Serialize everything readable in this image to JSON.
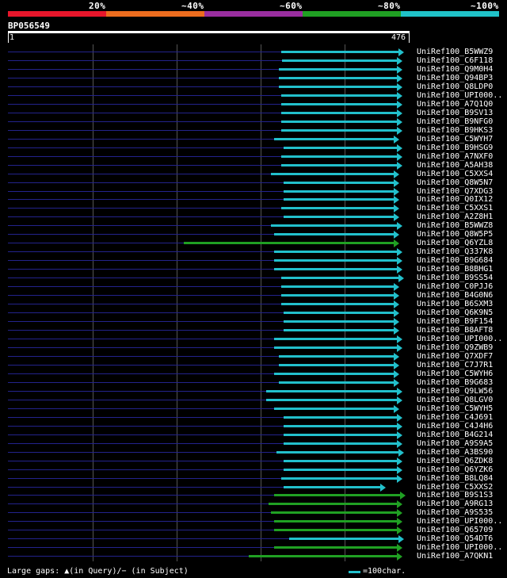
{
  "identity_legend": {
    "labels": [
      "20%",
      "~40%",
      "~60%",
      "~80%",
      "~100%"
    ],
    "colors": [
      "#e8162b",
      "#ec6c1e",
      "#9a2ea0",
      "#20a023",
      "#20c2c8"
    ]
  },
  "query": {
    "id": "BP056549",
    "start": "1",
    "end": "476"
  },
  "hits": [
    {
      "name": "UniRef100_B5WWZ9",
      "start": 355,
      "end": 503,
      "color": "#22c0cc",
      "arrow": true
    },
    {
      "name": "UniRef100_C6F118",
      "start": 356,
      "end": 501,
      "color": "#22c0cc",
      "arrow": true
    },
    {
      "name": "UniRef100_Q9M0H4",
      "start": 352,
      "end": 501,
      "color": "#22c0cc",
      "arrow": true
    },
    {
      "name": "UniRef100_Q94BP3",
      "start": 352,
      "end": 501,
      "color": "#22c0cc",
      "arrow": true
    },
    {
      "name": "UniRef100_Q8LDP0",
      "start": 352,
      "end": 501,
      "color": "#22c0cc",
      "arrow": true
    },
    {
      "name": "UniRef100_UPI000..",
      "start": 355,
      "end": 501,
      "color": "#22c0cc",
      "arrow": true
    },
    {
      "name": "UniRef100_A7Q1Q0",
      "start": 355,
      "end": 501,
      "color": "#22c0cc",
      "arrow": true
    },
    {
      "name": "UniRef100_B9SV13",
      "start": 355,
      "end": 501,
      "color": "#22c0cc",
      "arrow": true
    },
    {
      "name": "UniRef100_B9NFG0",
      "start": 355,
      "end": 501,
      "color": "#22c0cc",
      "arrow": true
    },
    {
      "name": "UniRef100_B9HKS3",
      "start": 355,
      "end": 501,
      "color": "#22c0cc",
      "arrow": true
    },
    {
      "name": "UniRef100_C5WYH7",
      "start": 346,
      "end": 497,
      "color": "#22c0cc",
      "arrow": true
    },
    {
      "name": "UniRef100_B9HSG9",
      "start": 358,
      "end": 501,
      "color": "#22c0cc",
      "arrow": true
    },
    {
      "name": "UniRef100_A7NXF0",
      "start": 355,
      "end": 501,
      "color": "#22c0cc",
      "arrow": true
    },
    {
      "name": "UniRef100_A5AH38",
      "start": 355,
      "end": 501,
      "color": "#22c0cc",
      "arrow": true
    },
    {
      "name": "UniRef100_C5XXS4",
      "start": 342,
      "end": 497,
      "color": "#22c0cc",
      "arrow": true
    },
    {
      "name": "UniRef100_Q8W5N7",
      "start": 358,
      "end": 497,
      "color": "#22c0cc",
      "arrow": true
    },
    {
      "name": "UniRef100_Q7XDG3",
      "start": 358,
      "end": 497,
      "color": "#22c0cc",
      "arrow": true
    },
    {
      "name": "UniRef100_Q0IX12",
      "start": 358,
      "end": 497,
      "color": "#22c0cc",
      "arrow": true
    },
    {
      "name": "UniRef100_C5XXS1",
      "start": 355,
      "end": 497,
      "color": "#22c0cc",
      "arrow": true
    },
    {
      "name": "UniRef100_A2Z8H1",
      "start": 358,
      "end": 497,
      "color": "#22c0cc",
      "arrow": true
    },
    {
      "name": "UniRef100_B5WWZ8",
      "start": 342,
      "end": 501,
      "color": "#22c0cc",
      "arrow": true
    },
    {
      "name": "UniRef100_Q8W5P5",
      "start": 346,
      "end": 497,
      "color": "#22c0cc",
      "arrow": true
    },
    {
      "name": "UniRef100_Q6YZL8",
      "start": 232,
      "end": 497,
      "color": "#20a023",
      "arrow": true
    },
    {
      "name": "UniRef100_Q337K8",
      "start": 346,
      "end": 501,
      "color": "#22c0cc",
      "arrow": true
    },
    {
      "name": "UniRef100_B9G684",
      "start": 346,
      "end": 501,
      "color": "#22c0cc",
      "arrow": true
    },
    {
      "name": "UniRef100_B8BHG1",
      "start": 346,
      "end": 501,
      "color": "#22c0cc",
      "arrow": true
    },
    {
      "name": "UniRef100_B9SS54",
      "start": 355,
      "end": 503,
      "color": "#22c0cc",
      "arrow": true
    },
    {
      "name": "UniRef100_C0PJJ6",
      "start": 355,
      "end": 497,
      "color": "#22c0cc",
      "arrow": true
    },
    {
      "name": "UniRef100_B4G0N6",
      "start": 355,
      "end": 497,
      "color": "#22c0cc",
      "arrow": true
    },
    {
      "name": "UniRef100_B6SXM3",
      "start": 355,
      "end": 497,
      "color": "#22c0cc",
      "arrow": true
    },
    {
      "name": "UniRef100_Q6K9N5",
      "start": 358,
      "end": 497,
      "color": "#22c0cc",
      "arrow": true
    },
    {
      "name": "UniRef100_B9F154",
      "start": 358,
      "end": 497,
      "color": "#22c0cc",
      "arrow": true
    },
    {
      "name": "UniRef100_B8AFT8",
      "start": 358,
      "end": 497,
      "color": "#22c0cc",
      "arrow": true
    },
    {
      "name": "UniRef100_UPI000..",
      "start": 346,
      "end": 501,
      "color": "#22c0cc",
      "arrow": true
    },
    {
      "name": "UniRef100_Q9ZWB9",
      "start": 346,
      "end": 501,
      "color": "#22c0cc",
      "arrow": true
    },
    {
      "name": "UniRef100_Q7XDF7",
      "start": 352,
      "end": 497,
      "color": "#22c0cc",
      "arrow": true
    },
    {
      "name": "UniRef100_C7J7R1",
      "start": 352,
      "end": 497,
      "color": "#22c0cc",
      "arrow": true
    },
    {
      "name": "UniRef100_C5WYH6",
      "start": 346,
      "end": 497,
      "color": "#22c0cc",
      "arrow": true
    },
    {
      "name": "UniRef100_B9G683",
      "start": 352,
      "end": 497,
      "color": "#22c0cc",
      "arrow": true
    },
    {
      "name": "UniRef100_Q9LW56",
      "start": 336,
      "end": 501,
      "color": "#22c0cc",
      "arrow": true
    },
    {
      "name": "UniRef100_Q8LGV0",
      "start": 336,
      "end": 501,
      "color": "#22c0cc",
      "arrow": true
    },
    {
      "name": "UniRef100_C5WYH5",
      "start": 346,
      "end": 497,
      "color": "#22c0cc",
      "arrow": true
    },
    {
      "name": "UniRef100_C4J691",
      "start": 358,
      "end": 501,
      "color": "#22c0cc",
      "arrow": true
    },
    {
      "name": "UniRef100_C4J4H6",
      "start": 358,
      "end": 501,
      "color": "#22c0cc",
      "arrow": true
    },
    {
      "name": "UniRef100_B4G214",
      "start": 358,
      "end": 501,
      "color": "#22c0cc",
      "arrow": true
    },
    {
      "name": "UniRef100_A9S9A5",
      "start": 358,
      "end": 501,
      "color": "#22c0cc",
      "arrow": true
    },
    {
      "name": "UniRef100_A3BS90",
      "start": 349,
      "end": 503,
      "color": "#22c0cc",
      "arrow": true
    },
    {
      "name": "UniRef100_Q6ZDK8",
      "start": 358,
      "end": 501,
      "color": "#22c0cc",
      "arrow": true
    },
    {
      "name": "UniRef100_Q6YZK6",
      "start": 358,
      "end": 501,
      "color": "#22c0cc",
      "arrow": true
    },
    {
      "name": "UniRef100_B8LQ84",
      "start": 355,
      "end": 501,
      "color": "#22c0cc",
      "arrow": true
    },
    {
      "name": "UniRef100_C5XXS2",
      "start": 358,
      "end": 480,
      "color": "#22c0cc",
      "arrow": true
    },
    {
      "name": "UniRef100_B9S1S3",
      "start": 346,
      "end": 505,
      "color": "#20a023",
      "arrow": true
    },
    {
      "name": "UniRef100_A9RG13",
      "start": 339,
      "end": 501,
      "color": "#20a023",
      "arrow": true
    },
    {
      "name": "UniRef100_A9S535",
      "start": 342,
      "end": 501,
      "color": "#20a023",
      "arrow": true
    },
    {
      "name": "UniRef100_UPI000..",
      "start": 346,
      "end": 501,
      "color": "#20a023",
      "arrow": true
    },
    {
      "name": "UniRef100_Q65709",
      "start": 346,
      "end": 501,
      "color": "#20a023",
      "arrow": true
    },
    {
      "name": "UniRef100_Q54DT6",
      "start": 365,
      "end": 503,
      "color": "#22c0cc",
      "arrow": true
    },
    {
      "name": "UniRef100_UPI000..",
      "start": 346,
      "end": 501,
      "color": "#20a023",
      "arrow": true
    },
    {
      "name": "UniRef100_A7QKN1",
      "start": 314,
      "end": 501,
      "color": "#20a023",
      "arrow": true
    }
  ],
  "footer": {
    "gaps_text": "Large gaps: ▲(in Query)/− (in Subject)",
    "scale_text": "=100char."
  }
}
